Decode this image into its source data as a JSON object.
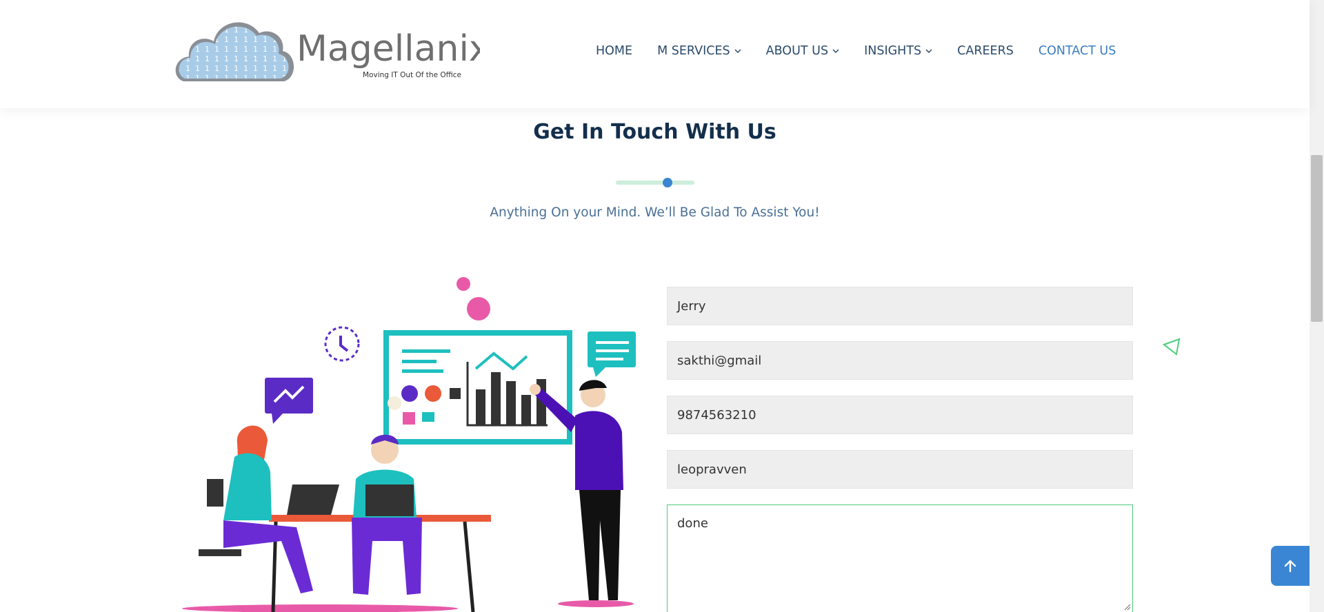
{
  "header": {
    "logo": {
      "name": "Magellanix",
      "tagline": "Moving IT Out Of the Office"
    },
    "nav": [
      {
        "label": "HOME",
        "dropdown": false
      },
      {
        "label": "M SERVICES",
        "dropdown": true
      },
      {
        "label": "ABOUT US",
        "dropdown": true
      },
      {
        "label": "INSIGHTS",
        "dropdown": true
      },
      {
        "label": "CAREERS",
        "dropdown": false
      },
      {
        "label": "CONTACT US",
        "dropdown": false,
        "active": true
      }
    ]
  },
  "section": {
    "title": "Get In Touch With Us",
    "subtitle": "Anything On your Mind. We’ll Be Glad To Assist You!"
  },
  "form": {
    "name": "Jerry",
    "email": "sakthi@gmail",
    "phone": "9874563210",
    "subject": "leopravven",
    "message": "done"
  },
  "icons": {
    "scroll_top": "arrow-up-icon",
    "decor": "triangle-outline-icon"
  },
  "colors": {
    "accent": "#3a86d4",
    "heading": "#132f4c",
    "nav_active": "#3a7cc0",
    "textarea_border": "#4ccc7a"
  }
}
